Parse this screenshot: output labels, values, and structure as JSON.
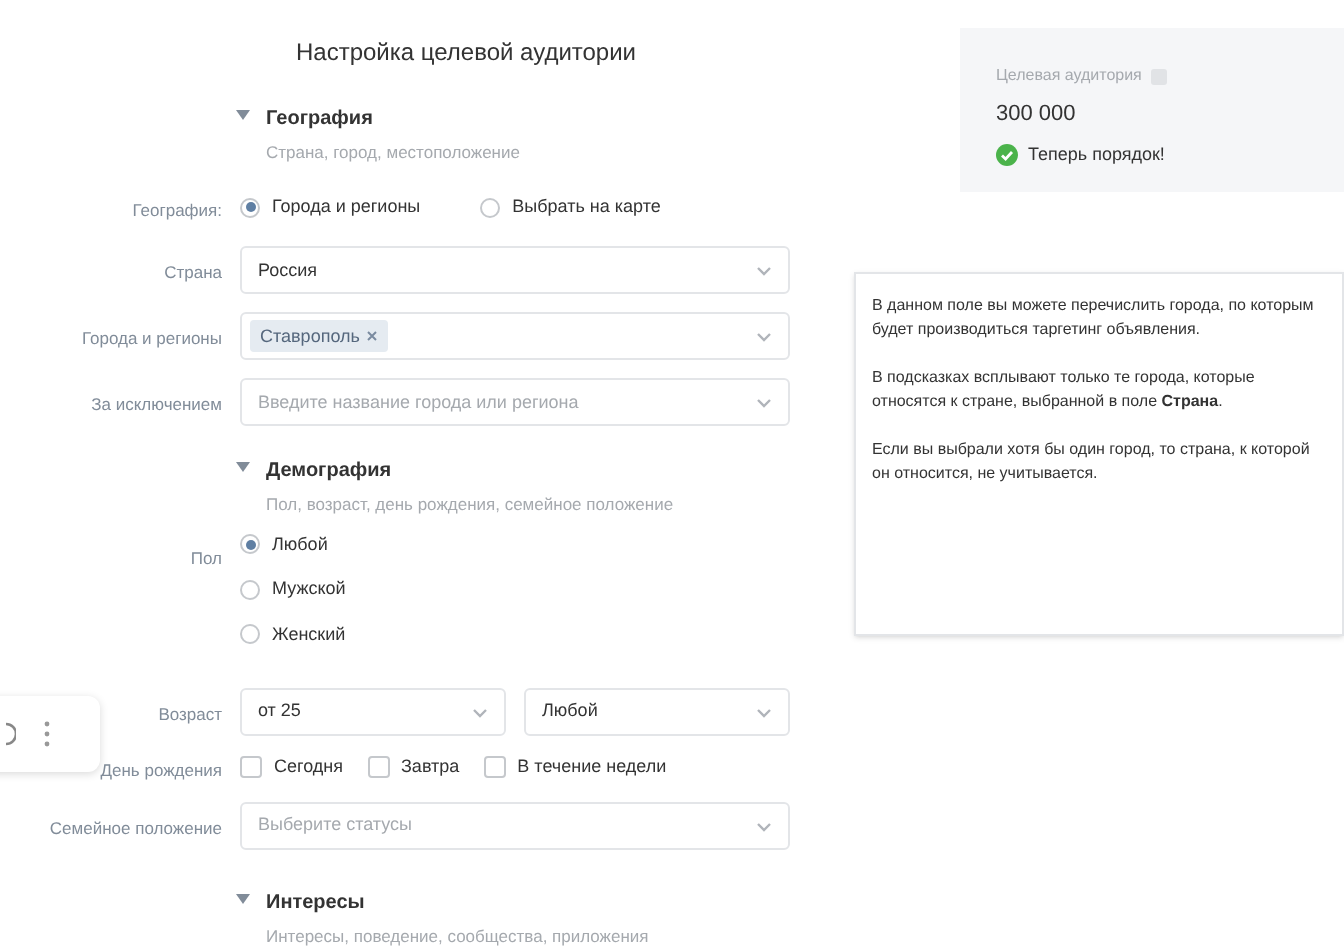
{
  "title": "Настройка целевой аудитории",
  "sections": [
    {
      "title": "География",
      "subtitle": "Страна, город, местоположение",
      "expanded": true,
      "fields": [
        {
          "kind": "radio",
          "label": "География:",
          "options": [
            {
              "label": "Города и регионы",
              "selected": true
            },
            {
              "label": "Выбрать на карте",
              "selected": false
            }
          ]
        },
        {
          "kind": "select",
          "label": "Страна",
          "value": "Россия"
        },
        {
          "kind": "tags",
          "label": "Города и регионы",
          "tags": [
            "Ставрополь"
          ]
        },
        {
          "kind": "select",
          "label": "За исключением",
          "placeholder": "Введите название города или региона"
        }
      ]
    },
    {
      "title": "Демография",
      "subtitle": "Пол, возраст, день рождения, семейное положение",
      "expanded": true,
      "fields": [
        {
          "kind": "radio_column",
          "label": "Пол",
          "options": [
            {
              "label": "Любой",
              "selected": true
            },
            {
              "label": "Мужской",
              "selected": false
            },
            {
              "label": "Женский",
              "selected": false
            }
          ]
        },
        {
          "kind": "select_pair",
          "label": "Возраст",
          "values": [
            "от 25",
            "Любой"
          ]
        },
        {
          "kind": "checkbox",
          "label": "День рождения",
          "options": [
            {
              "label": "Сегодня",
              "checked": false
            },
            {
              "label": "Завтра",
              "checked": false
            },
            {
              "label": "В течение недели",
              "checked": false
            }
          ]
        },
        {
          "kind": "select",
          "label": "Семейное положение",
          "placeholder": "Выберите статусы"
        }
      ]
    },
    {
      "title": "Интересы",
      "subtitle": "Интересы, поведение, сообщества, приложения",
      "expanded": true
    }
  ],
  "audience": {
    "label": "Целевая аудитория",
    "value": "300 000",
    "status": "Теперь порядок!"
  },
  "hint": {
    "paragraphs": [
      "В данном поле вы можете перечислить города, по которым будет производиться таргетинг объявления.",
      "В подсказках всплывают только те города, которые относятся к стране, выбранной в поле **Страна**.",
      "Если вы выбрали хотя бы один город, то страна, к которой он относится, не учитывается."
    ]
  }
}
